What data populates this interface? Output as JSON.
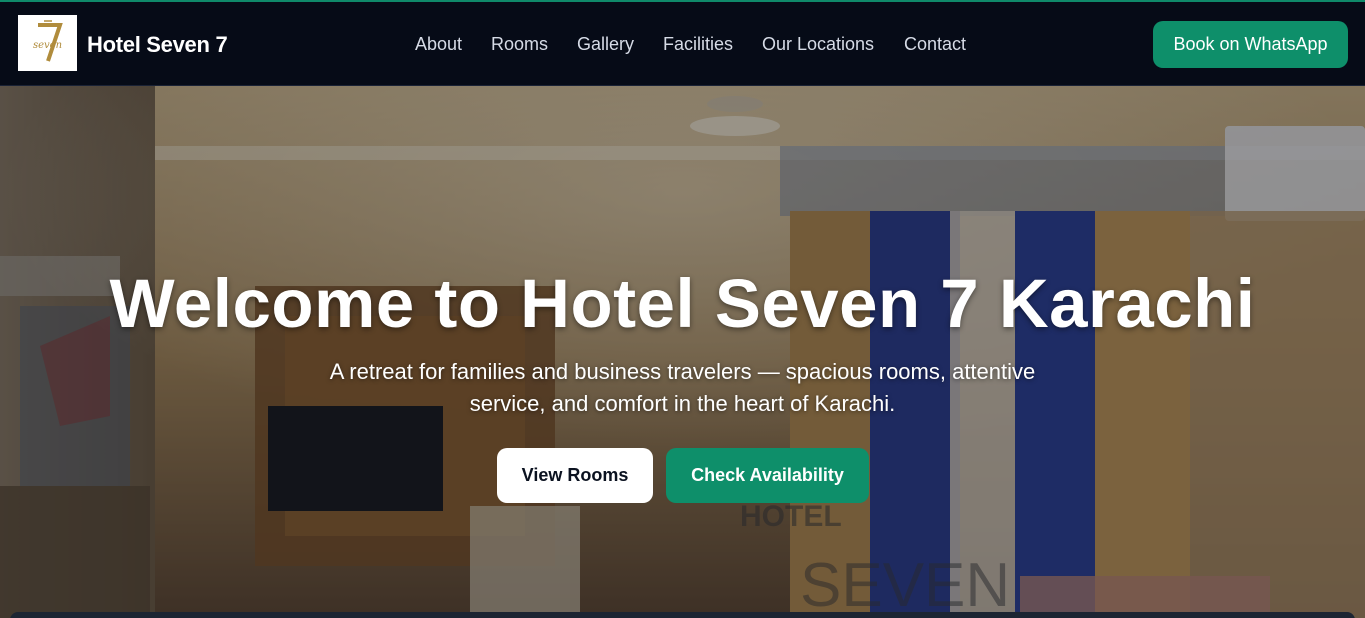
{
  "header": {
    "logo": {
      "text": "seven",
      "icon": "hotel-logo-icon"
    },
    "brand": "Hotel Seven 7",
    "nav": [
      {
        "label": "About"
      },
      {
        "label": "Rooms"
      },
      {
        "label": "Gallery"
      },
      {
        "label": "Facilities"
      },
      {
        "label": "Our Locations"
      },
      {
        "label": "Contact"
      }
    ],
    "cta_label": "Book on WhatsApp"
  },
  "hero": {
    "title": "Welcome to Hotel Seven 7 Karachi",
    "subtitle": "A retreat for families and business travelers — spacious rooms, attentive service, and comfort in the heart of Karachi.",
    "primary_button": "View Rooms",
    "secondary_button": "Check Availability",
    "background_sign": {
      "line1": "HOTEL",
      "line2": "SEVEN"
    }
  },
  "colors": {
    "accent": "#0e8f6a",
    "header_bg": "#060b17",
    "text_light": "#ffffff"
  }
}
